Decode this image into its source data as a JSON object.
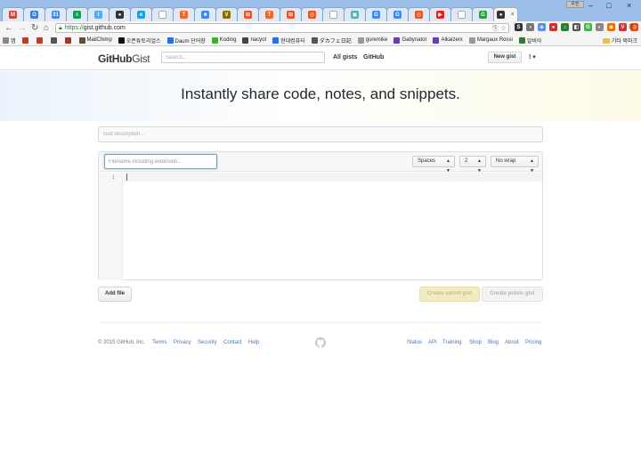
{
  "browser": {
    "tabs": [
      {
        "icon": "gmail-icon",
        "glyph": "M",
        "color": "#d44638"
      },
      {
        "icon": "circle-site-icon",
        "glyph": "O",
        "color": "#3b7dd8"
      },
      {
        "icon": "calendar-icon",
        "glyph": "31",
        "color": "#4a86e8"
      },
      {
        "icon": "sheets-icon",
        "glyph": "≡",
        "color": "#0f9d58"
      },
      {
        "icon": "twitter-icon",
        "glyph": "t",
        "color": "#55acee"
      },
      {
        "icon": "github-icon",
        "glyph": "●",
        "color": "#333333"
      },
      {
        "icon": "ie-icon",
        "glyph": "e",
        "color": "#1ba1e2"
      },
      {
        "icon": "blank-page-icon",
        "glyph": "",
        "color": "#ffffff"
      },
      {
        "icon": "orange-t-icon",
        "glyph": "T",
        "color": "#f26522"
      },
      {
        "icon": "docs-icon",
        "glyph": "■",
        "color": "#4285f4"
      },
      {
        "icon": "v-logo-icon",
        "glyph": "V",
        "color": "#8a6d00"
      },
      {
        "icon": "windows-icon",
        "glyph": "⊞",
        "color": "#f25022"
      },
      {
        "icon": "orange-t-icon",
        "glyph": "T",
        "color": "#f26522"
      },
      {
        "icon": "windows-icon",
        "glyph": "⊞",
        "color": "#f25022"
      },
      {
        "icon": "ubuntu-icon",
        "glyph": "◎",
        "color": "#e95420"
      },
      {
        "icon": "blank-page-icon",
        "glyph": "",
        "color": "#ffffff"
      },
      {
        "icon": "image-icon",
        "glyph": "▣",
        "color": "#4db6ac"
      },
      {
        "icon": "google-icon",
        "glyph": "G",
        "color": "#4285f4"
      },
      {
        "icon": "google-icon",
        "glyph": "G",
        "color": "#4285f4"
      },
      {
        "icon": "ubuntu-icon",
        "glyph": "◎",
        "color": "#e95420"
      },
      {
        "icon": "youtube-icon",
        "glyph": "▶",
        "color": "#e62117"
      },
      {
        "icon": "blank-page-icon",
        "glyph": "",
        "color": "#ffffff"
      },
      {
        "icon": "green-g-icon",
        "glyph": "G",
        "color": "#2e9e45"
      }
    ],
    "active_tab_close": "×",
    "user_badge": "우진",
    "window_controls": {
      "minimize": "–",
      "maximize": "□",
      "close": "×"
    },
    "url_scheme": "https://",
    "url_rest": "gist.github.com",
    "bookmarks": [
      {
        "label": "앱",
        "color": "#888"
      },
      {
        "label": "",
        "color": "#c0392b"
      },
      {
        "label": "",
        "color": "#c0392b"
      },
      {
        "label": "",
        "color": "#555"
      },
      {
        "label": "",
        "color": "#a93226"
      },
      {
        "label": "MailChimp",
        "color": "#6b4c2a"
      },
      {
        "label": "오픈튜토리얼스",
        "color": "#111"
      },
      {
        "label": "Daum 단어장",
        "color": "#2a6fdb"
      },
      {
        "label": "Koding",
        "color": "#45ae2b"
      },
      {
        "label": "nacyot",
        "color": "#444"
      },
      {
        "label": "현대컴퓨터",
        "color": "#2a6fdb"
      },
      {
        "label": "ダカフェ日記",
        "color": "#555"
      },
      {
        "label": "guremike",
        "color": "#999"
      },
      {
        "label": "Gabynator",
        "color": "#6441a5"
      },
      {
        "label": "Alkaizerx",
        "color": "#6441a5"
      },
      {
        "label": "Margaux Rossi",
        "color": "#999"
      },
      {
        "label": "알비아",
        "color": "#2e7d32"
      }
    ],
    "other_bookmarks": "기타 북마크"
  },
  "header": {
    "logo_github": "GitHub",
    "logo_gist": "Gist",
    "search_placeholder": "Search...",
    "all_gists": "All gists",
    "github": "GitHub",
    "new_gist": "New gist",
    "user_menu": "! ▾"
  },
  "hero": {
    "title": "Instantly share code, notes, and snippets."
  },
  "form": {
    "description_placeholder": "Gist description...",
    "filename_placeholder": "Filename including extension...",
    "indent_mode": "Spaces",
    "indent_size": "2",
    "wrap_mode": "No wrap",
    "line_number": "1"
  },
  "buttons": {
    "add_file": "Add file",
    "create_secret": "Create secret gist",
    "create_public": "Create public gist"
  },
  "footer": {
    "copyright": "© 2015 GitHub, Inc.",
    "left_links": [
      "Terms",
      "Privacy",
      "Security",
      "Contact",
      "Help"
    ],
    "right_links": [
      "Status",
      "API",
      "Training",
      "Shop",
      "Blog",
      "About",
      "Pricing"
    ]
  }
}
